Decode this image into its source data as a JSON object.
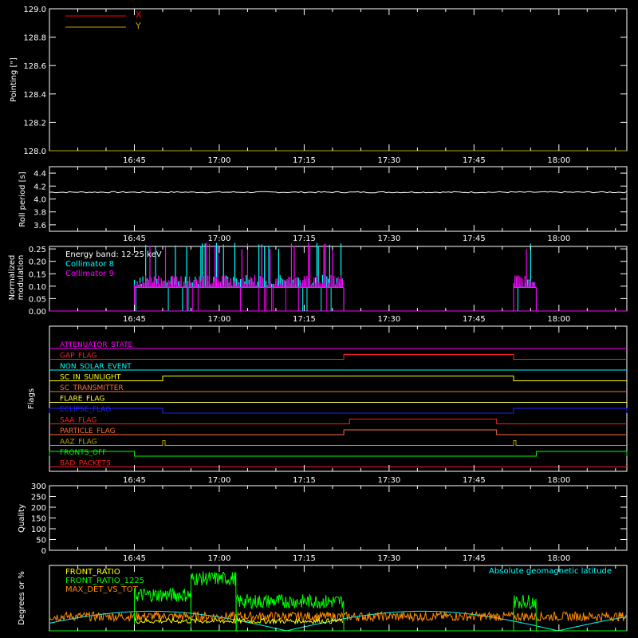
{
  "figure": {
    "background": "#000000",
    "axis_color": "#ffffff",
    "xticks": [
      "16:45",
      "17:00",
      "17:15",
      "17:30",
      "17:45",
      "18:00"
    ]
  },
  "chart_data": [
    {
      "id": "pointing",
      "type": "line",
      "ylabel": "Pointing [\"]",
      "yticks": [
        "128.0",
        "128.2",
        "128.4",
        "128.6",
        "128.8",
        "129.0"
      ],
      "ylim": [
        128.0,
        129.0
      ],
      "xlim": [
        "16:30",
        "18:12"
      ],
      "legend": [
        {
          "name": "X",
          "color": "#ff0000"
        },
        {
          "name": "Y",
          "color": "#b8a800"
        }
      ],
      "legend_position": "top-left",
      "series": [
        {
          "name": "X",
          "color": "#ff0000",
          "x": [
            "16:30",
            "18:12"
          ],
          "values": [
            128.0,
            128.0
          ]
        },
        {
          "name": "Y",
          "color": "#b8a800",
          "x": [
            "16:30",
            "18:12"
          ],
          "values": [
            128.0,
            128.0
          ]
        }
      ]
    },
    {
      "id": "roll",
      "type": "line",
      "ylabel": "Roll period [s]",
      "yticks": [
        "3.6",
        "3.8",
        "4.0",
        "4.2",
        "4.4"
      ],
      "ylim": [
        3.5,
        4.5
      ],
      "xlim": [
        "16:30",
        "18:12"
      ],
      "series": [
        {
          "color": "#ffffff",
          "x": [
            "16:30",
            "16:40",
            "16:50",
            "17:00",
            "17:10",
            "17:20",
            "17:30",
            "17:40",
            "17:50",
            "18:00",
            "18:12"
          ],
          "values": [
            4.11,
            4.1,
            4.11,
            4.1,
            4.12,
            4.11,
            4.1,
            4.12,
            4.11,
            4.1,
            4.1
          ]
        }
      ]
    },
    {
      "id": "modulation",
      "type": "line",
      "ylabel": "Normalized modulation",
      "ylabel_lines": [
        "Normalized",
        "modulation"
      ],
      "yticks": [
        "0.00",
        "0.05",
        "0.10",
        "0.15",
        "0.20",
        "0.25"
      ],
      "ylim": [
        0,
        0.26
      ],
      "xlim": [
        "16:30",
        "18:12"
      ],
      "legend": [
        {
          "name": "Energy band: 12-25 keV",
          "color": "#ffffff"
        },
        {
          "name": "Collimator 8",
          "color": "#00ffff"
        },
        {
          "name": "Collimator 9",
          "color": "#ff00ff"
        }
      ],
      "legend_position": "top-left",
      "series": [
        {
          "name": "Collimator 8",
          "color": "#00ffff",
          "active_intervals": [
            [
              "16:45",
              "17:22"
            ],
            [
              "17:52",
              "17:56"
            ]
          ],
          "baseline": 0.095,
          "peak": 0.25
        },
        {
          "name": "Collimator 9",
          "color": "#ff00ff",
          "active_intervals": [
            [
              "16:45",
              "17:22"
            ],
            [
              "17:52",
              "17:56"
            ]
          ],
          "baseline": 0.095,
          "peak": 0.25
        }
      ]
    },
    {
      "id": "flags",
      "type": "line",
      "ylabel": "Flags",
      "xlim": [
        "16:30",
        "18:12"
      ],
      "flags": [
        {
          "label": "ATTENUATOR_STATE",
          "color": "#ff00ff",
          "high": []
        },
        {
          "label": "GAP_FLAG",
          "color": "#ff2020",
          "high": [
            [
              "17:22",
              "17:52"
            ]
          ]
        },
        {
          "label": "NON_SOLAR_EVENT",
          "color": "#00ffff",
          "high": []
        },
        {
          "label": "SC_IN_SUNLIGHT",
          "color": "#ffff00",
          "high": [
            [
              "16:50",
              "17:52"
            ]
          ]
        },
        {
          "label": "SC_TRANSMITTER",
          "color": "#ff7030",
          "high": []
        },
        {
          "label": "FLARE_FLAG",
          "color": "#ffff40",
          "high": []
        },
        {
          "label": "ECLIPSE_FLAG",
          "color": "#2020ff",
          "high": [
            [
              "16:30",
              "16:50"
            ],
            [
              "17:52",
              "18:12"
            ]
          ]
        },
        {
          "label": "SAA_FLAG",
          "color": "#ff2020",
          "high": [
            [
              "17:23",
              "17:49"
            ]
          ]
        },
        {
          "label": "PARTICLE_FLAG",
          "color": "#ff7030",
          "high": [
            [
              "17:22",
              "17:49"
            ]
          ]
        },
        {
          "label": "AAZ_FLAG",
          "color": "#b8a800",
          "high": [
            [
              "16:50",
              "16:50"
            ],
            [
              "17:52",
              "17:52"
            ]
          ]
        },
        {
          "label": "FRONTS_OFF",
          "color": "#00ff00",
          "high": [
            [
              "16:30",
              "16:45"
            ],
            [
              "17:56",
              "18:12"
            ]
          ]
        },
        {
          "label": "BAD_PACKETS",
          "color": "#ff2020",
          "high": []
        }
      ]
    },
    {
      "id": "quality",
      "type": "line",
      "ylabel": "Quality",
      "yticks": [
        "0",
        "50",
        "100",
        "150",
        "200",
        "250",
        "300"
      ],
      "ylim": [
        0,
        300
      ],
      "xlim": [
        "16:30",
        "18:12"
      ],
      "series": []
    },
    {
      "id": "ratios",
      "type": "line",
      "ylabel": "Degrees or %",
      "xlim": [
        "16:30",
        "18:12"
      ],
      "legend": [
        {
          "name": "FRONT_RATIO",
          "color": "#ffff00"
        },
        {
          "name": "FRONT_RATIO_1225",
          "color": "#00ff00"
        },
        {
          "name": "MAX_DET_VS_TOT",
          "color": "#ff8c00"
        }
      ],
      "legend_right": {
        "name": "Absolute geomagnetic latitude",
        "color": "#00ffff"
      },
      "series": [
        {
          "name": "FRONT_RATIO_1225",
          "color": "#00ff00",
          "segments": [
            {
              "x": [
                "16:45",
                "16:55"
              ],
              "level": 55
            },
            {
              "x": [
                "16:55",
                "17:03"
              ],
              "level": 80
            },
            {
              "x": [
                "17:03",
                "17:22"
              ],
              "level": 45
            },
            {
              "x": [
                "17:52",
                "17:56"
              ],
              "level": 45
            }
          ]
        },
        {
          "name": "MAX_DET_VS_TOT",
          "color": "#ff8c00",
          "x": [
            "16:30",
            "18:12"
          ],
          "level": 22
        },
        {
          "name": "FRONT_RATIO",
          "color": "#ffff00",
          "x": [
            "16:45",
            "17:22"
          ],
          "level": 15
        },
        {
          "name": "Absolute geomagnetic latitude",
          "color": "#00ffff",
          "x": [
            "16:30",
            "18:12"
          ],
          "amplitude": 30
        }
      ]
    }
  ]
}
